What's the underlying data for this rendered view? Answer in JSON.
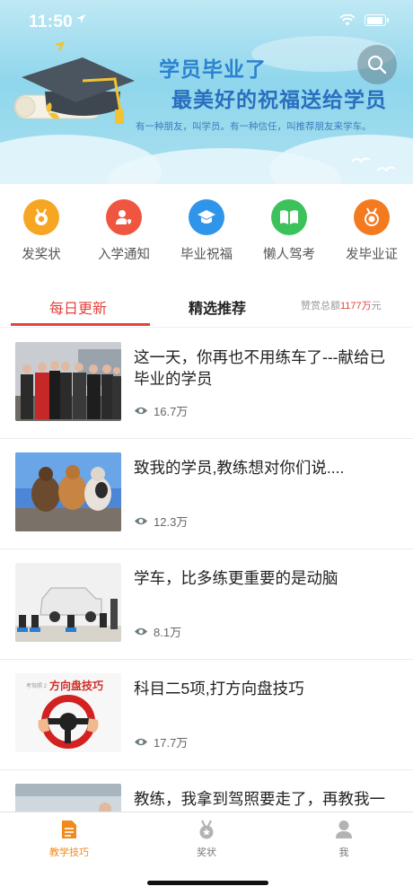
{
  "status": {
    "time": "11:50"
  },
  "banner": {
    "title_line1": "学员毕业了",
    "title_line2": "最美好的祝福送给学员",
    "subtitle": "有一种朋友，叫学员。有一种信任，叫推荐朋友来学车。"
  },
  "quick_actions": [
    {
      "label": "发奖状",
      "icon": "award-medal-icon",
      "color": "#f6a623"
    },
    {
      "label": "入学通知",
      "icon": "user-heart-icon",
      "color": "#f0553f"
    },
    {
      "label": "毕业祝福",
      "icon": "graduation-cap-icon",
      "color": "#2f95ea"
    },
    {
      "label": "懒人驾考",
      "icon": "book-icon",
      "color": "#3cc25a"
    },
    {
      "label": "发毕业证",
      "icon": "medal-icon",
      "color": "#f47a1f"
    }
  ],
  "tabs": {
    "daily": "每日更新",
    "featured": "精选推荐",
    "total_prefix": "赞赏总额",
    "total_amount": "1177万",
    "total_suffix": "元"
  },
  "articles": [
    {
      "title": "这一天，你再也不用练车了---献给已毕业的学员",
      "views": "16.7万"
    },
    {
      "title": "致我的学员,教练想对你们说....",
      "views": "12.3万"
    },
    {
      "title": "学车，比多练更重要的是动脑",
      "views": "8.1万"
    },
    {
      "title": "科目二5项,打方向盘技巧",
      "views": "17.7万",
      "thumb_caption": "方向盘技巧",
      "thumb_small": "考驾照 2"
    },
    {
      "title": "教练，我拿到驾照要走了，再教我一次吧!（看哭了...）"
    }
  ],
  "tabbar": [
    {
      "label": "教学技巧",
      "active": true
    },
    {
      "label": "奖状",
      "active": false
    },
    {
      "label": "我",
      "active": false
    }
  ],
  "colors": {
    "accent": "#e2423d",
    "active_tab": "#f08a1c"
  }
}
